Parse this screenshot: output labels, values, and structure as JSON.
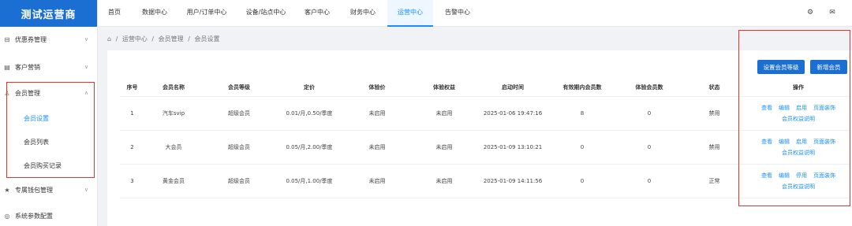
{
  "app": {
    "title": "测试运营商"
  },
  "sidebar": {
    "items": [
      {
        "label": "优惠券管理",
        "icon": "coupon-icon"
      },
      {
        "label": "客户营销",
        "icon": "marketing-icon"
      },
      {
        "label": "会员管理",
        "icon": "member-icon"
      },
      {
        "label": "专属钱包管理",
        "icon": "star-icon"
      },
      {
        "label": "系统参数配置",
        "icon": "settings-icon"
      }
    ],
    "sub_items": [
      {
        "label": "会员设置",
        "active": true
      },
      {
        "label": "会员列表",
        "active": false
      },
      {
        "label": "会员购买记录",
        "active": false
      }
    ]
  },
  "topnav": {
    "items": [
      {
        "label": "首页"
      },
      {
        "label": "数据中心"
      },
      {
        "label": "用户/订单中心"
      },
      {
        "label": "设备/站点中心"
      },
      {
        "label": "客户中心"
      },
      {
        "label": "财务中心"
      },
      {
        "label": "运营中心",
        "active": true
      },
      {
        "label": "告警中心"
      }
    ]
  },
  "breadcrumb": [
    "运营中心",
    "/",
    "会员管理",
    "/",
    "会员设置"
  ],
  "buttons": {
    "set_level": "设置会员等级",
    "add_member": "新增会员"
  },
  "table": {
    "headers": [
      "序号",
      "会员名称",
      "会员等级",
      "定价",
      "体验价",
      "体验权益",
      "启动时间",
      "有效期内会员数",
      "体验会员数",
      "状态",
      "操作"
    ],
    "rows": [
      {
        "no": "1",
        "name": "汽车svip",
        "level": "超级会员",
        "price": "0.01/月,0.50/季度",
        "trial_price": "未启用",
        "trial_benefit": "未启用",
        "start_time": "2025-01-06 19:47:16",
        "valid_count": "8",
        "trial_count": "0",
        "status": "禁用",
        "ops": [
          "查看",
          "编辑",
          "启用",
          "页面装饰"
        ],
        "ops2": "会员权益说明"
      },
      {
        "no": "2",
        "name": "大会员",
        "level": "超级会员",
        "price": "0.05/月,2.00/季度",
        "trial_price": "未启用",
        "trial_benefit": "未启用",
        "start_time": "2025-01-09 13:10:21",
        "valid_count": "0",
        "trial_count": "0",
        "status": "禁用",
        "ops": [
          "查看",
          "编辑",
          "启用",
          "页面装饰"
        ],
        "ops2": "会员权益说明"
      },
      {
        "no": "3",
        "name": "黄金会员",
        "level": "超级会员",
        "price": "0.05/月,1.00/季度",
        "trial_price": "未启用",
        "trial_benefit": "未启用",
        "start_time": "2025-01-09 14:11:56",
        "valid_count": "0",
        "trial_count": "0",
        "status": "正常",
        "ops": [
          "查看",
          "编辑",
          "停用",
          "页面装饰"
        ],
        "ops2": "会员权益说明"
      }
    ]
  },
  "colors": {
    "brand": "#1b6fd3",
    "link": "#1890ff",
    "highlight_box": "#e0362c"
  }
}
